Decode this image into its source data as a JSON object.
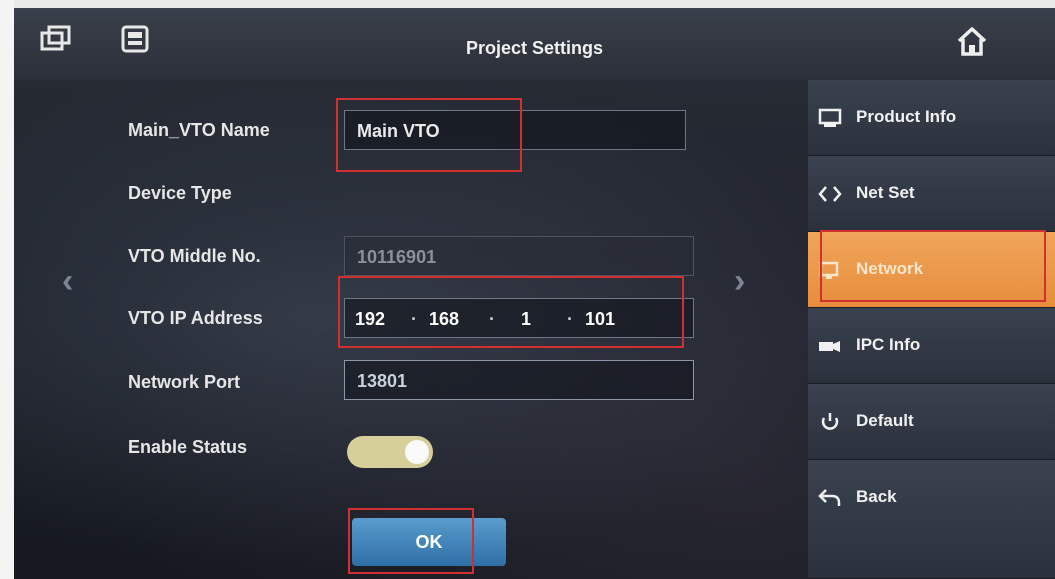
{
  "header": {
    "title": "Project Settings"
  },
  "form": {
    "main_vto_name_label": "Main_VTO Name",
    "main_vto_name_value": "Main VTO",
    "device_type_label": "Device Type",
    "vto_middle_no_label": "VTO Middle No.",
    "vto_middle_no_value": "10116901",
    "vto_ip_address_label": "VTO IP Address",
    "ip": [
      "192",
      "168",
      "1",
      "101"
    ],
    "network_port_label": "Network Port",
    "network_port_value": "13801",
    "enable_status_label": "Enable Status",
    "enable_status_on": true,
    "ok_label": "OK"
  },
  "sidebar": {
    "items": [
      {
        "label": "Product Info",
        "icon": "monitor-icon"
      },
      {
        "label": "Net Set",
        "icon": "code-brackets-icon"
      },
      {
        "label": "Network",
        "icon": "network-icon",
        "active": true
      },
      {
        "label": "IPC Info",
        "icon": "camera-icon"
      },
      {
        "label": "Default",
        "icon": "reset-icon"
      },
      {
        "label": "Back",
        "icon": "back-arrow-icon"
      }
    ]
  },
  "colors": {
    "accent": "#e78d3d",
    "highlight": "#d23030",
    "ok": "#2f6fa7"
  }
}
